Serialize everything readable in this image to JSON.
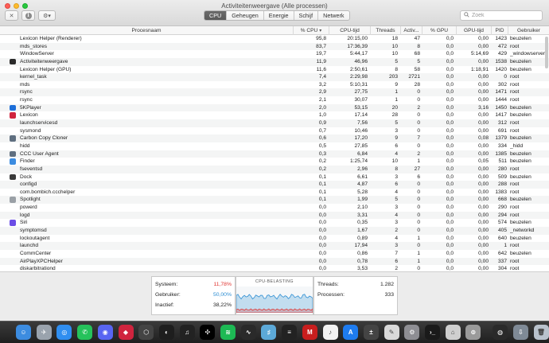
{
  "window": {
    "title": "Activiteitenweergave (Alle processen)"
  },
  "toolbar": {
    "close_glyph": "✕",
    "info_glyph": "i",
    "gear_glyph": "⚙▾",
    "tabs": [
      {
        "label": "CPU",
        "active": true
      },
      {
        "label": "Geheugen",
        "active": false
      },
      {
        "label": "Energie",
        "active": false
      },
      {
        "label": "Schijf",
        "active": false
      },
      {
        "label": "Netwerk",
        "active": false
      }
    ],
    "search_placeholder": "Zoek"
  },
  "table": {
    "columns": {
      "name": "Procesnaam",
      "cpu": "% CPU",
      "cputime": "CPU-tijd",
      "threads": "Threads",
      "wake": "Activ...",
      "gpu": "% GPU",
      "gputime": "GPU-tijd",
      "pid": "PID",
      "user": "Gebruiker"
    },
    "sorted_column": "cpu",
    "rows": [
      {
        "name": "Lexicon Helper (Renderer)",
        "cpu": "95,8",
        "cputime": "20:15,00",
        "threads": "18",
        "wake": "47",
        "gpu": "0,0",
        "gputime": "0,00",
        "pid": "1423",
        "user": "beuzelen",
        "icon": ""
      },
      {
        "name": "mds_stores",
        "cpu": "83,7",
        "cputime": "17:36,39",
        "threads": "10",
        "wake": "8",
        "gpu": "0,0",
        "gputime": "0,00",
        "pid": "472",
        "user": "root",
        "icon": ""
      },
      {
        "name": "WindowServer",
        "cpu": "19,7",
        "cputime": "5:44,17",
        "threads": "10",
        "wake": "68",
        "gpu": "0,0",
        "gputime": "5:14,69",
        "pid": "429",
        "user": "_windowserver",
        "icon": ""
      },
      {
        "name": "Activiteitenweergave",
        "cpu": "11,9",
        "cputime": "46,96",
        "threads": "5",
        "wake": "5",
        "gpu": "0,0",
        "gputime": "0,00",
        "pid": "1538",
        "user": "beuzelen",
        "icon": "activity"
      },
      {
        "name": "Lexicon Helper (GPU)",
        "cpu": "11,6",
        "cputime": "2:50,61",
        "threads": "8",
        "wake": "58",
        "gpu": "0,0",
        "gputime": "1:18,91",
        "pid": "1420",
        "user": "beuzelen",
        "icon": ""
      },
      {
        "name": "kernel_task",
        "cpu": "7,4",
        "cputime": "2:29,98",
        "threads": "203",
        "wake": "2721",
        "gpu": "0,0",
        "gputime": "0,00",
        "pid": "0",
        "user": "root",
        "icon": ""
      },
      {
        "name": "mds",
        "cpu": "3,2",
        "cputime": "5:10,31",
        "threads": "9",
        "wake": "28",
        "gpu": "0,0",
        "gputime": "0,00",
        "pid": "302",
        "user": "root",
        "icon": ""
      },
      {
        "name": "rsync",
        "cpu": "2,9",
        "cputime": "27,75",
        "threads": "1",
        "wake": "0",
        "gpu": "0,0",
        "gputime": "0,00",
        "pid": "1471",
        "user": "root",
        "icon": ""
      },
      {
        "name": "rsync",
        "cpu": "2,1",
        "cputime": "30,07",
        "threads": "1",
        "wake": "0",
        "gpu": "0,0",
        "gputime": "0,00",
        "pid": "1444",
        "user": "root",
        "icon": ""
      },
      {
        "name": "5KPlayer",
        "cpu": "2,0",
        "cputime": "53,15",
        "threads": "20",
        "wake": "2",
        "gpu": "0,0",
        "gputime": "3,16",
        "pid": "1450",
        "user": "beuzelen",
        "icon": "5kplayer"
      },
      {
        "name": "Lexicon",
        "cpu": "1,0",
        "cputime": "17,14",
        "threads": "28",
        "wake": "0",
        "gpu": "0,0",
        "gputime": "0,00",
        "pid": "1417",
        "user": "beuzelen",
        "icon": "lexicon"
      },
      {
        "name": "launchservicesd",
        "cpu": "0,9",
        "cputime": "7,56",
        "threads": "5",
        "wake": "0",
        "gpu": "0,0",
        "gputime": "0,00",
        "pid": "312",
        "user": "root",
        "icon": ""
      },
      {
        "name": "sysmond",
        "cpu": "0,7",
        "cputime": "10,46",
        "threads": "3",
        "wake": "0",
        "gpu": "0,0",
        "gputime": "0,00",
        "pid": "691",
        "user": "root",
        "icon": ""
      },
      {
        "name": "Carbon Copy Cloner",
        "cpu": "0,6",
        "cputime": "17,20",
        "threads": "9",
        "wake": "7",
        "gpu": "0,0",
        "gputime": "0,08",
        "pid": "1379",
        "user": "beuzelen",
        "icon": "ccc"
      },
      {
        "name": "hidd",
        "cpu": "0,5",
        "cputime": "27,85",
        "threads": "6",
        "wake": "0",
        "gpu": "0,0",
        "gputime": "0,00",
        "pid": "334",
        "user": "_hidd",
        "icon": ""
      },
      {
        "name": "CCC User Agent",
        "cpu": "0,3",
        "cputime": "6,84",
        "threads": "4",
        "wake": "2",
        "gpu": "0,0",
        "gputime": "0,00",
        "pid": "1385",
        "user": "beuzelen",
        "icon": "ccc"
      },
      {
        "name": "Finder",
        "cpu": "0,2",
        "cputime": "1:25,74",
        "threads": "10",
        "wake": "1",
        "gpu": "0,0",
        "gputime": "0,05",
        "pid": "511",
        "user": "beuzelen",
        "icon": "finder"
      },
      {
        "name": "fseventsd",
        "cpu": "0,2",
        "cputime": "2,96",
        "threads": "8",
        "wake": "27",
        "gpu": "0,0",
        "gputime": "0,00",
        "pid": "280",
        "user": "root",
        "icon": ""
      },
      {
        "name": "Dock",
        "cpu": "0,1",
        "cputime": "6,61",
        "threads": "3",
        "wake": "6",
        "gpu": "0,0",
        "gputime": "0,00",
        "pid": "509",
        "user": "beuzelen",
        "icon": "dock"
      },
      {
        "name": "configd",
        "cpu": "0,1",
        "cputime": "4,87",
        "threads": "6",
        "wake": "0",
        "gpu": "0,0",
        "gputime": "0,00",
        "pid": "288",
        "user": "root",
        "icon": ""
      },
      {
        "name": "com.bombich.ccchelper",
        "cpu": "0,1",
        "cputime": "5,28",
        "threads": "4",
        "wake": "0",
        "gpu": "0,0",
        "gputime": "0,00",
        "pid": "1383",
        "user": "root",
        "icon": ""
      },
      {
        "name": "Spotlight",
        "cpu": "0,1",
        "cputime": "1,99",
        "threads": "5",
        "wake": "0",
        "gpu": "0,0",
        "gputime": "0,00",
        "pid": "668",
        "user": "beuzelen",
        "icon": "spotlight"
      },
      {
        "name": "powerd",
        "cpu": "0,0",
        "cputime": "2,10",
        "threads": "3",
        "wake": "0",
        "gpu": "0,0",
        "gputime": "0,00",
        "pid": "290",
        "user": "root",
        "icon": ""
      },
      {
        "name": "logd",
        "cpu": "0,0",
        "cputime": "3,31",
        "threads": "4",
        "wake": "0",
        "gpu": "0,0",
        "gputime": "0,00",
        "pid": "294",
        "user": "root",
        "icon": ""
      },
      {
        "name": "Siri",
        "cpu": "0,0",
        "cputime": "0,35",
        "threads": "3",
        "wake": "0",
        "gpu": "0,0",
        "gputime": "0,00",
        "pid": "574",
        "user": "beuzelen",
        "icon": "siri"
      },
      {
        "name": "symptomsd",
        "cpu": "0,0",
        "cputime": "1,67",
        "threads": "2",
        "wake": "0",
        "gpu": "0,0",
        "gputime": "0,00",
        "pid": "405",
        "user": "_networkd",
        "icon": ""
      },
      {
        "name": "lockoutagent",
        "cpu": "0,0",
        "cputime": "0,89",
        "threads": "4",
        "wake": "1",
        "gpu": "0,0",
        "gputime": "0,00",
        "pid": "640",
        "user": "beuzelen",
        "icon": ""
      },
      {
        "name": "launchd",
        "cpu": "0,0",
        "cputime": "17,94",
        "threads": "3",
        "wake": "0",
        "gpu": "0,0",
        "gputime": "0,00",
        "pid": "1",
        "user": "root",
        "icon": ""
      },
      {
        "name": "CommCenter",
        "cpu": "0,0",
        "cputime": "0,86",
        "threads": "7",
        "wake": "1",
        "gpu": "0,0",
        "gputime": "0,00",
        "pid": "642",
        "user": "beuzelen",
        "icon": ""
      },
      {
        "name": "AirPlayXPCHelper",
        "cpu": "0,0",
        "cputime": "0,78",
        "threads": "6",
        "wake": "1",
        "gpu": "0,0",
        "gputime": "0,00",
        "pid": "337",
        "user": "root",
        "icon": ""
      },
      {
        "name": "diskarbitrationd",
        "cpu": "0,0",
        "cputime": "3,53",
        "threads": "2",
        "wake": "0",
        "gpu": "0,0",
        "gputime": "0,00",
        "pid": "304",
        "user": "root",
        "icon": ""
      }
    ]
  },
  "summary": {
    "system_label": "Systeem:",
    "system_value": "11,78%",
    "user_label": "Gebruiker:",
    "user_value": "50,00%",
    "idle_label": "Inactief:",
    "idle_value": "38,22%",
    "graph_title": "CPU-BELASTING",
    "threads_label": "Threads:",
    "threads_value": "1.282",
    "processes_label": "Processen:",
    "processes_value": "333"
  },
  "colors": {
    "system": "#e0332f",
    "user": "#2d8ed3",
    "graph_bg": "#f5f7f9"
  },
  "dock": [
    {
      "name": "finder-icon",
      "color": "#3c8ce0",
      "glyph": "☺"
    },
    {
      "name": "launchpad-icon",
      "color": "#9aa3ad",
      "glyph": "✈"
    },
    {
      "name": "safari-icon",
      "color": "#2f8ef0",
      "glyph": "◎"
    },
    {
      "name": "whatsapp-icon",
      "color": "#25c25b",
      "glyph": "✆"
    },
    {
      "name": "discord-icon",
      "color": "#5865f2",
      "glyph": "◉"
    },
    {
      "name": "lexicon-icon",
      "color": "#d0243e",
      "glyph": "◆"
    },
    {
      "name": "package-icon",
      "color": "#444444",
      "glyph": "⬡"
    },
    {
      "name": "pdf-icon",
      "color": "#1e1e1e",
      "glyph": "◐"
    },
    {
      "name": "headphones-icon",
      "color": "#222222",
      "glyph": "♫"
    },
    {
      "name": "tidal-icon",
      "color": "#000000",
      "glyph": "✣"
    },
    {
      "name": "spotify-icon",
      "color": "#1db954",
      "glyph": "≋"
    },
    {
      "name": "activity-monitor-icon",
      "color": "#2a2a2a",
      "glyph": "∿"
    },
    {
      "name": "mixed-in-key-icon",
      "color": "#5ca9d8",
      "glyph": "♯"
    },
    {
      "name": "mix-key-icon",
      "color": "#222222",
      "glyph": "≡"
    },
    {
      "name": "akai-mpx-icon",
      "color": "#c81e1e",
      "glyph": "M"
    },
    {
      "name": "music-icon",
      "color": "#f2f2f2",
      "glyph": "♪"
    },
    {
      "name": "app-store-icon",
      "color": "#1e7cf0",
      "glyph": "A"
    },
    {
      "name": "calculator-icon",
      "color": "#444444",
      "glyph": "±"
    },
    {
      "name": "script-editor-icon",
      "color": "#d9d9d9",
      "glyph": "✎"
    },
    {
      "name": "system-preferences-icon",
      "color": "#8e8e93",
      "glyph": "⚙"
    },
    {
      "name": "terminal-icon",
      "color": "#1a1a1a",
      "glyph": "›_"
    },
    {
      "name": "utility-icon",
      "color": "#cfcfcf",
      "glyph": "⌂"
    },
    {
      "name": "disk-utility-icon",
      "color": "#9a9a9a",
      "glyph": "⊚"
    },
    {
      "name": "dvd-player-icon",
      "color": "#2a2a2a",
      "glyph": "◍"
    },
    {
      "name": "downloads-stack-icon",
      "color": "#7f8a96",
      "glyph": "⇩"
    },
    {
      "name": "trash-icon",
      "color": "#b9c2cc",
      "glyph": "🗑"
    }
  ]
}
